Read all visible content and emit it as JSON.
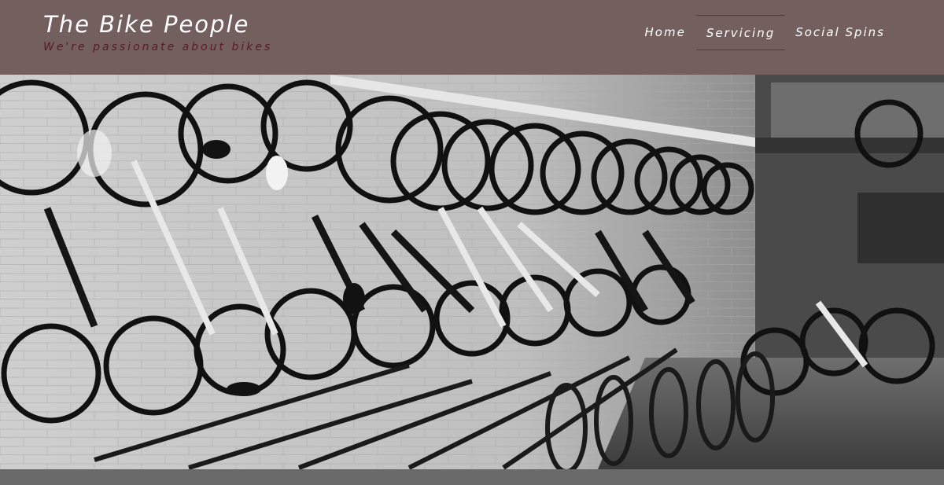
{
  "site": {
    "title": "The Bike People",
    "tagline": "We're passionate about bikes"
  },
  "nav": {
    "items": [
      {
        "label": "Home",
        "active": false
      },
      {
        "label": "Servicing",
        "active": true
      },
      {
        "label": "Social Spins",
        "active": false
      }
    ]
  },
  "hero": {
    "image_subject": "bicycles hanging on shop wall",
    "style": "grayscale"
  },
  "colors": {
    "header_bg": "#745f5f",
    "tagline": "#5a1a24",
    "nav_active_border": "#7a2a33",
    "footer_bar": "#6a6a6a"
  }
}
